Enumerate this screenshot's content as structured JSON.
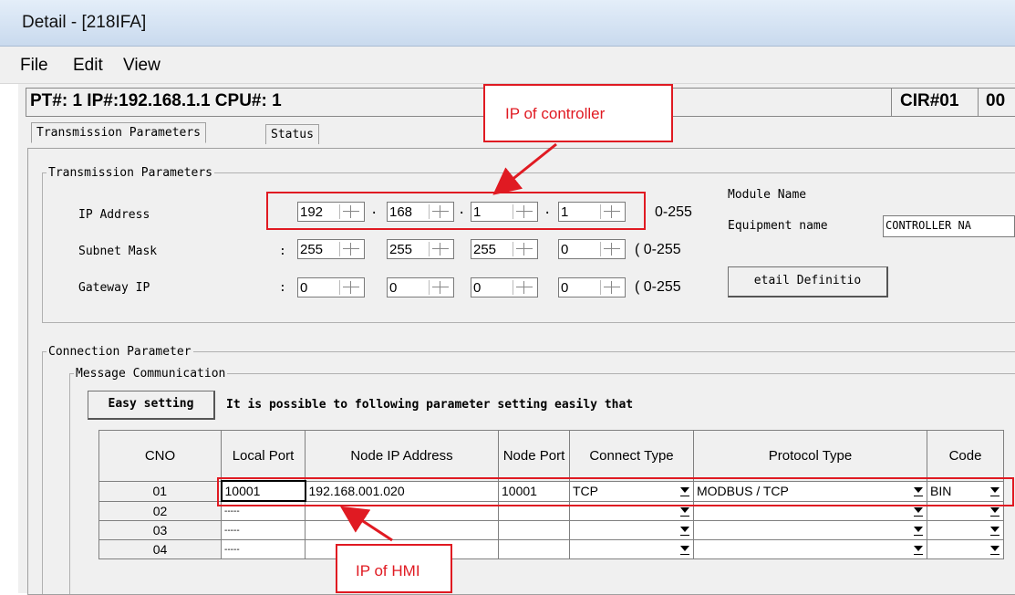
{
  "window": {
    "title": "Detail - [218IFA]"
  },
  "menu": [
    "File",
    "Edit",
    "View"
  ],
  "infobar": {
    "text": "PT#: 1 IP#:192.168.1.1 CPU#: 1",
    "cir": "CIR#01",
    "cir_right": "00"
  },
  "tabs": [
    "Transmission Parameters",
    "Status"
  ],
  "transmission": {
    "legend": "Transmission Parameters",
    "ip_label": "IP Address",
    "ip": [
      "192",
      "168",
      "1",
      "1"
    ],
    "ip_range": "0-255",
    "subnet_label": "Subnet  Mask",
    "subnet": [
      "255",
      "255",
      "255",
      "0"
    ],
    "subnet_range": "( 0-255",
    "gateway_label": "Gateway IP",
    "gateway": [
      "0",
      "0",
      "0",
      "0"
    ],
    "gateway_range": "( 0-255",
    "colon": ":",
    "module_name_label": "Module Name",
    "equipment_label": "Equipment  name",
    "equipment_value": "CONTROLLER NA",
    "detail_button": "etail Definitio"
  },
  "connection": {
    "legend": "Connection Parameter",
    "message_legend": "Message Communication",
    "easy_button": "Easy setting",
    "easy_text": "It is possible to following parameter setting easily that"
  },
  "table": {
    "headers": [
      "CNO",
      "Local Port",
      "Node IP Address",
      "Node Port",
      "Connect Type",
      "Protocol Type",
      "Code"
    ],
    "rows": [
      {
        "cno": "01",
        "local": "10001",
        "ip": "192.168.001.020",
        "port": "10001",
        "connect": "TCP",
        "protocol": "MODBUS / TCP",
        "code": "BIN"
      },
      {
        "cno": "02",
        "local": "-----",
        "ip": "",
        "port": "",
        "connect": "",
        "protocol": "",
        "code": ""
      },
      {
        "cno": "03",
        "local": "-----",
        "ip": "",
        "port": "",
        "connect": "",
        "protocol": "",
        "code": ""
      },
      {
        "cno": "04",
        "local": "-----",
        "ip": "",
        "port": "",
        "connect": "",
        "protocol": "",
        "code": ""
      }
    ]
  },
  "annotations": {
    "controller": "IP of controller",
    "hmi": "IP of HMI",
    "color": "#e01a22"
  }
}
